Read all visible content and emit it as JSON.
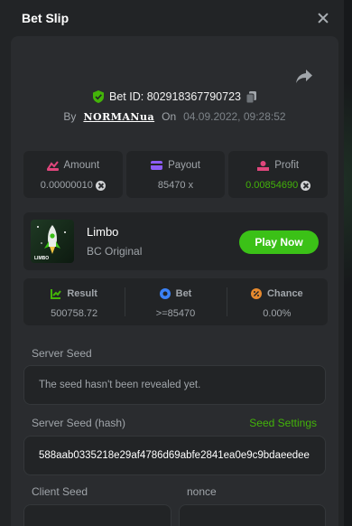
{
  "dialog": {
    "title": "Bet Slip"
  },
  "bet": {
    "id_label": "Bet ID: 802918367790723",
    "by_label": "By",
    "username": "NORMANua",
    "on_label": "On",
    "date": "04.09.2022, 09:28:52"
  },
  "stats": {
    "amount_label": "Amount",
    "amount_value": "0.00000010",
    "payout_label": "Payout",
    "payout_value": "85470 x",
    "profit_label": "Profit",
    "profit_value": "0.00854690"
  },
  "game": {
    "name": "Limbo",
    "subtitle": "BC Original",
    "play_label": "Play Now",
    "thumb_text": "LIMBO"
  },
  "result": {
    "result_label": "Result",
    "result_value": "500758.72",
    "bet_label": "Bet",
    "bet_value": ">=85470",
    "chance_label": "Chance",
    "chance_value": "0.00%"
  },
  "seeds": {
    "server_seed_label": "Server Seed",
    "server_seed_value": "The seed hasn't been revealed yet.",
    "server_hash_label": "Server Seed (hash)",
    "seed_settings_label": "Seed Settings",
    "server_hash_value": "588aab0335218e29af4786d69abfe2841ea0e9c9bdaeedee",
    "client_seed_label": "Client Seed",
    "nonce_label": "nonce"
  },
  "colors": {
    "accent_green": "#43b309",
    "play_button": "#3bc117",
    "amount_icon": "#e0467c",
    "payout_icon": "#8c5cf5",
    "profit_icon": "#e0467c",
    "result_icon": "#43b309",
    "bet_icon": "#3b82f6",
    "chance_icon": "#e6892e"
  }
}
